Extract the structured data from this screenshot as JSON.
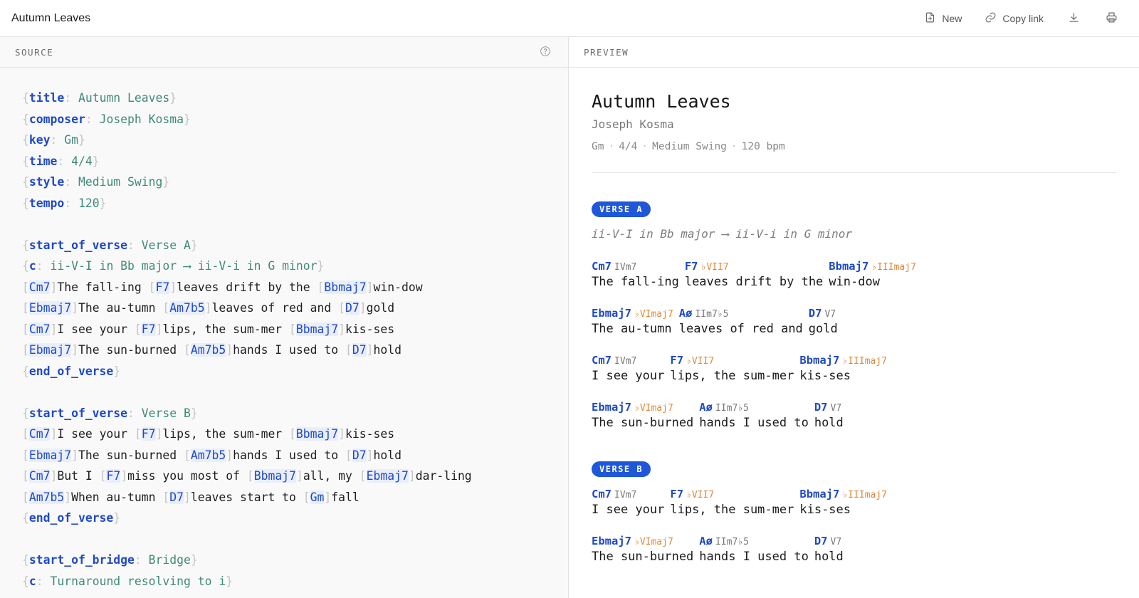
{
  "header": {
    "title": "Autumn Leaves",
    "new_label": "New",
    "copy_link_label": "Copy link"
  },
  "source": {
    "header": "SOURCE",
    "lines": [
      {
        "type": "directive",
        "kw": "title",
        "val": "Autumn Leaves"
      },
      {
        "type": "directive",
        "kw": "composer",
        "val": "Joseph Kosma"
      },
      {
        "type": "directive",
        "kw": "key",
        "val": "Gm"
      },
      {
        "type": "directive",
        "kw": "time",
        "val": "4/4"
      },
      {
        "type": "directive",
        "kw": "style",
        "val": "Medium Swing"
      },
      {
        "type": "directive",
        "kw": "tempo",
        "val": "120"
      },
      {
        "type": "blank"
      },
      {
        "type": "directive",
        "kw": "start_of_verse",
        "val": "Verse A"
      },
      {
        "type": "directive",
        "kw": "c",
        "val": "ii-V-I in Bb major ⟶ ii-V-i in G minor"
      },
      {
        "type": "chords",
        "parts": [
          {
            "chord": "Cm7",
            "text": "The fall-ing "
          },
          {
            "chord": "F7",
            "text": "leaves drift by the "
          },
          {
            "chord": "Bbmaj7",
            "text": "win-dow"
          }
        ]
      },
      {
        "type": "chords",
        "parts": [
          {
            "chord": "Ebmaj7",
            "text": "The au-tumn "
          },
          {
            "chord": "Am7b5",
            "text": "leaves of red and "
          },
          {
            "chord": "D7",
            "text": "gold"
          }
        ]
      },
      {
        "type": "chords",
        "parts": [
          {
            "chord": "Cm7",
            "text": "I see your "
          },
          {
            "chord": "F7",
            "text": "lips, the sum-mer "
          },
          {
            "chord": "Bbmaj7",
            "text": "kis-ses"
          }
        ]
      },
      {
        "type": "chords",
        "parts": [
          {
            "chord": "Ebmaj7",
            "text": "The sun-burned "
          },
          {
            "chord": "Am7b5",
            "text": "hands I used to "
          },
          {
            "chord": "D7",
            "text": "hold"
          }
        ]
      },
      {
        "type": "directive",
        "kw": "end_of_verse",
        "val": ""
      },
      {
        "type": "blank"
      },
      {
        "type": "directive",
        "kw": "start_of_verse",
        "val": "Verse B"
      },
      {
        "type": "chords",
        "parts": [
          {
            "chord": "Cm7",
            "text": "I see your "
          },
          {
            "chord": "F7",
            "text": "lips, the sum-mer "
          },
          {
            "chord": "Bbmaj7",
            "text": "kis-ses"
          }
        ]
      },
      {
        "type": "chords",
        "parts": [
          {
            "chord": "Ebmaj7",
            "text": "The sun-burned "
          },
          {
            "chord": "Am7b5",
            "text": "hands I used to "
          },
          {
            "chord": "D7",
            "text": "hold"
          }
        ]
      },
      {
        "type": "chords",
        "parts": [
          {
            "chord": "Cm7",
            "text": "But I "
          },
          {
            "chord": "F7",
            "text": "miss you most of "
          },
          {
            "chord": "Bbmaj7",
            "text": "all, my "
          },
          {
            "chord": "Ebmaj7",
            "text": "dar-ling"
          }
        ]
      },
      {
        "type": "chords",
        "parts": [
          {
            "chord": "Am7b5",
            "text": "When au-tumn "
          },
          {
            "chord": "D7",
            "text": "leaves start to "
          },
          {
            "chord": "Gm",
            "text": "fall"
          }
        ]
      },
      {
        "type": "directive",
        "kw": "end_of_verse",
        "val": ""
      },
      {
        "type": "blank"
      },
      {
        "type": "directive",
        "kw": "start_of_bridge",
        "val": "Bridge"
      },
      {
        "type": "directive",
        "kw": "c",
        "val": "Turnaround resolving to i"
      }
    ]
  },
  "preview": {
    "header": "PREVIEW",
    "title": "Autumn Leaves",
    "composer": "Joseph Kosma",
    "meta": [
      "Gm",
      "4/4",
      "Medium Swing",
      "120 bpm"
    ],
    "sections": [
      {
        "badge": "VERSE A",
        "comment": "ii-V-I in Bb major ⟶ ii-V-i in G minor",
        "lines": [
          [
            {
              "chord": "Cm7",
              "roman": "IVm7",
              "alt": false,
              "lyric": "The fall-ing"
            },
            {
              "chord": "F7",
              "roman": "♭VII7",
              "alt": true,
              "lyric": "leaves drift by the"
            },
            {
              "chord": "Bbmaj7",
              "roman": "♭IIImaj7",
              "alt": true,
              "lyric": "win-dow"
            }
          ],
          [
            {
              "chord": "Ebmaj7",
              "roman": "♭VImaj7",
              "alt": true,
              "lyric": "The au-tumn"
            },
            {
              "chord": "Aø",
              "roman": "IIm7♭5",
              "alt": false,
              "lyric": "leaves of red and"
            },
            {
              "chord": "D7",
              "roman": "V7",
              "alt": false,
              "lyric": "gold"
            }
          ],
          [
            {
              "chord": "Cm7",
              "roman": "IVm7",
              "alt": false,
              "lyric": "I see your"
            },
            {
              "chord": "F7",
              "roman": "♭VII7",
              "alt": true,
              "lyric": "lips, the sum-mer"
            },
            {
              "chord": "Bbmaj7",
              "roman": "♭IIImaj7",
              "alt": true,
              "lyric": "kis-ses"
            }
          ],
          [
            {
              "chord": "Ebmaj7",
              "roman": "♭VImaj7",
              "alt": true,
              "lyric": "The sun-burned"
            },
            {
              "chord": "Aø",
              "roman": "IIm7♭5",
              "alt": false,
              "lyric": "hands I used to"
            },
            {
              "chord": "D7",
              "roman": "V7",
              "alt": false,
              "lyric": "hold"
            }
          ]
        ]
      },
      {
        "badge": "VERSE B",
        "comment": "",
        "lines": [
          [
            {
              "chord": "Cm7",
              "roman": "IVm7",
              "alt": false,
              "lyric": "I see your"
            },
            {
              "chord": "F7",
              "roman": "♭VII7",
              "alt": true,
              "lyric": "lips, the sum-mer"
            },
            {
              "chord": "Bbmaj7",
              "roman": "♭IIImaj7",
              "alt": true,
              "lyric": "kis-ses"
            }
          ],
          [
            {
              "chord": "Ebmaj7",
              "roman": "♭VImaj7",
              "alt": true,
              "lyric": "The sun-burned"
            },
            {
              "chord": "Aø",
              "roman": "IIm7♭5",
              "alt": false,
              "lyric": "hands I used to"
            },
            {
              "chord": "D7",
              "roman": "V7",
              "alt": false,
              "lyric": "hold"
            }
          ]
        ]
      }
    ]
  },
  "colors": {
    "accent": "#1f57d9",
    "chord": "#1f49c8",
    "directive_value": "#3f8a78",
    "roman_alt": "#e0883a"
  },
  "icons": [
    "new-file-icon",
    "link-icon",
    "download-icon",
    "print-icon",
    "help-icon"
  ]
}
